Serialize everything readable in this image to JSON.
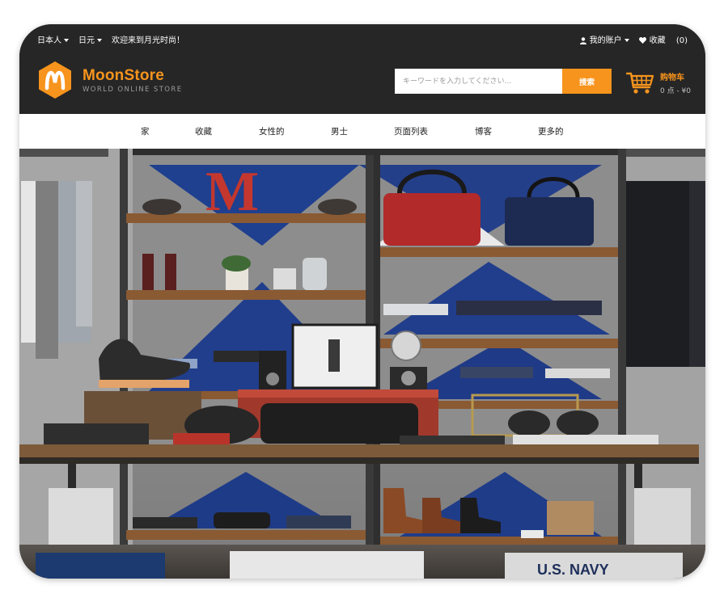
{
  "topbar": {
    "language": "日本人",
    "currency": "日元",
    "welcome": "欢迎来到月光时尚！",
    "account": "我的账户",
    "wishlist": "收藏",
    "wishlist_count": "(0)"
  },
  "brand": {
    "name": "MoonStore",
    "tagline": "WORLD ONLINE STORE",
    "accent": "#f7941d",
    "logo_letter": "M"
  },
  "search": {
    "placeholder": "キーワードを入力してください...",
    "button": "搜索"
  },
  "cart": {
    "label": "购物车",
    "summary": "0 点 - ¥0"
  },
  "nav": {
    "items": [
      "家",
      "收藏",
      "女性的",
      "男士",
      "页面列表",
      "博客",
      "更多的"
    ]
  },
  "hero": {
    "sign_letter": "M",
    "shirt_text": "U.S. NAVY"
  }
}
